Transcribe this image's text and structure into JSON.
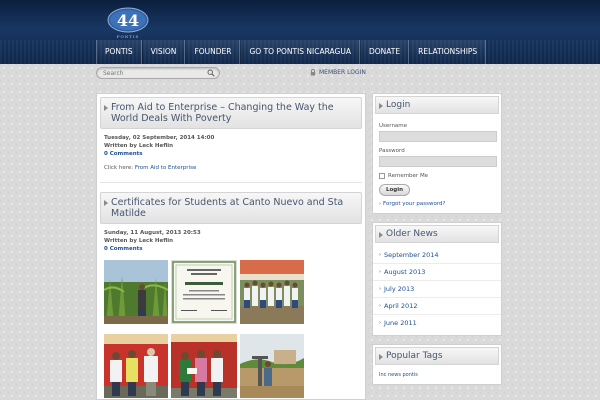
{
  "header": {
    "logo_text": "PONTIS",
    "nav": [
      "PONTIS",
      "VISION",
      "FOUNDER",
      "GO TO PONTIS NICARAGUA",
      "DONATE",
      "RELATIONSHIPS"
    ]
  },
  "search": {
    "placeholder": "Search"
  },
  "member_login": "MEMBER LOGIN",
  "articles": [
    {
      "title": "From Aid to Enterprise – Changing the Way the World Deals With Poverty",
      "date": "Tuesday, 02 September, 2014 14:00",
      "author": "Written by Leck Heflin",
      "comments": "0 Comments",
      "body_prefix": "Click here:",
      "body_link": "From Aid to Enterprise"
    },
    {
      "title": "Certificates for Students at Canto Nuevo and Sta Matilde",
      "date": "Sunday, 11 August, 2013 20:53",
      "author": "Written by Leck Heflin",
      "comments": "0 Comments"
    }
  ],
  "sidebar": {
    "login": {
      "title": "Login",
      "username_label": "Username",
      "password_label": "Password",
      "remember_label": "Remember Me",
      "button": "Login",
      "forgot": "Forgot your password?"
    },
    "older_news": {
      "title": "Older News",
      "items": [
        "September 2014",
        "August 2013",
        "July 2013",
        "April 2012",
        "June 2011"
      ]
    },
    "tags": {
      "title": "Popular Tags",
      "text": "Inc news pontis"
    }
  },
  "colors": {
    "header_dark": "#0c1f3d",
    "link_blue": "#1d4f91",
    "title_color": "#45566f"
  }
}
